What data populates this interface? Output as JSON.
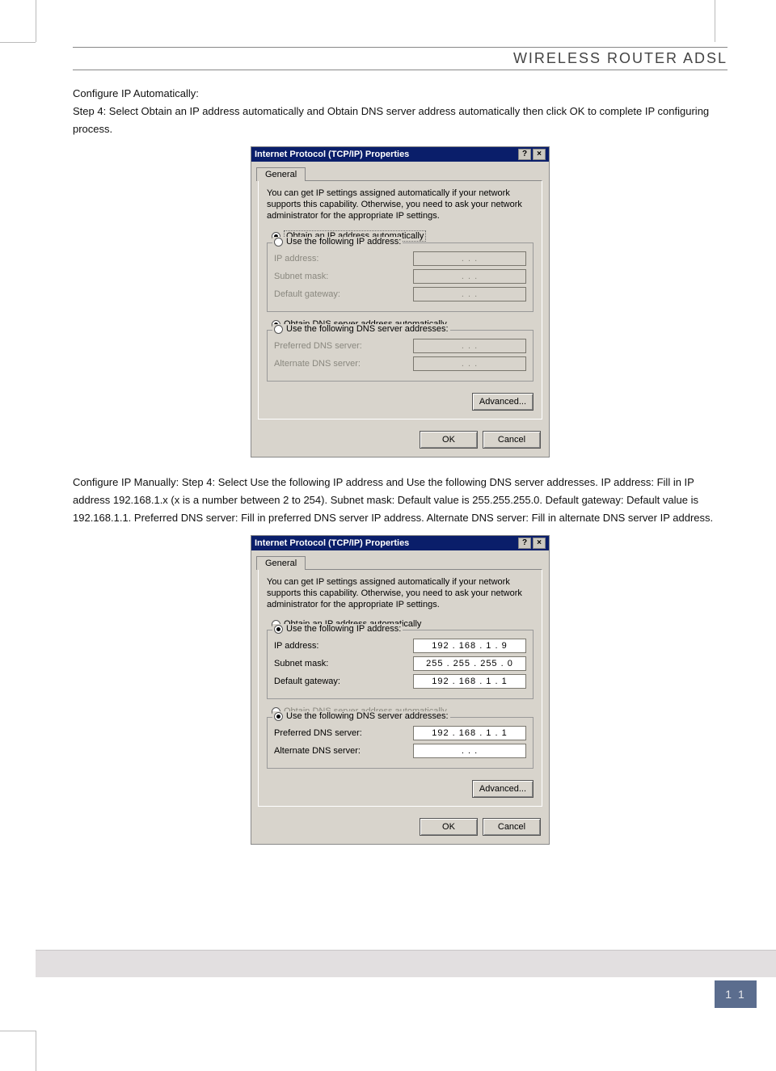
{
  "header": {
    "title": "WIRELESS ROUTER ADSL"
  },
  "page_number": "1 1",
  "text": {
    "auto_heading": "Configure IP Automatically:",
    "auto_step": "Step 4: Select Obtain an IP address automatically and Obtain DNS server address automatically then click OK to complete IP configuring process.",
    "manual_step": "Configure IP Manually: Step 4: Select Use the following IP address and Use the following DNS server addresses. IP address: Fill in IP address 192.168.1.x (x is a number between 2 to 254). Subnet mask: Default value is 255.255.255.0. Default gateway: Default value is 192.168.1.1. Preferred DNS server: Fill in preferred DNS server IP address. Alternate DNS server: Fill in alternate DNS server IP address."
  },
  "dialog": {
    "title": "Internet Protocol (TCP/IP) Properties",
    "help_btn": "?",
    "close_btn": "×",
    "tab": "General",
    "description": "You can get IP settings assigned automatically if your network supports this capability. Otherwise, you need to ask your network administrator for the appropriate IP settings.",
    "radio_obtain_ip": "Obtain an IP address automatically",
    "radio_use_ip": "Use the following IP address:",
    "label_ip": "IP address:",
    "label_subnet": "Subnet mask:",
    "label_gateway": "Default gateway:",
    "radio_obtain_dns": "Obtain DNS server address automatically",
    "radio_use_dns": "Use the following DNS server addresses:",
    "label_pref_dns": "Preferred DNS server:",
    "label_alt_dns": "Alternate DNS server:",
    "btn_advanced": "Advanced...",
    "btn_ok": "OK",
    "btn_cancel": "Cancel",
    "dots": ".       .       ."
  },
  "dialog2_values": {
    "ip": "192 . 168 .  1  .  9",
    "subnet": "255 . 255 . 255 .  0",
    "gateway": "192 . 168 .  1  .  1",
    "pref_dns": "192 . 168 .  1  .  1",
    "alt_dns": ".       .       ."
  }
}
